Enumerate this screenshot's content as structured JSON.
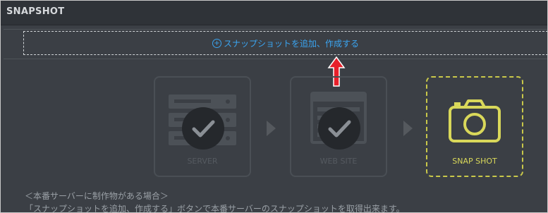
{
  "header": {
    "title": "SNAPSHOT"
  },
  "add_button": {
    "label": "スナップショットを追加、作成する",
    "icon": "plus-circle-icon"
  },
  "steps": [
    {
      "label": "SERVER",
      "icon": "server-icon",
      "state": "done"
    },
    {
      "label": "WEB SITE",
      "icon": "browser-window-icon",
      "state": "done"
    },
    {
      "label": "SNAP SHOT",
      "icon": "camera-icon",
      "state": "current"
    }
  ],
  "notes": [
    "＜本番サーバーに制作物がある場合＞",
    "「スナップショットを追加、作成する」ボタンで本番サーバーのスナップショットを取得出来ます。"
  ],
  "colors": {
    "accent": "#3ba4f0",
    "highlight": "#d9d85a",
    "annotation_arrow": "#e8202a"
  }
}
